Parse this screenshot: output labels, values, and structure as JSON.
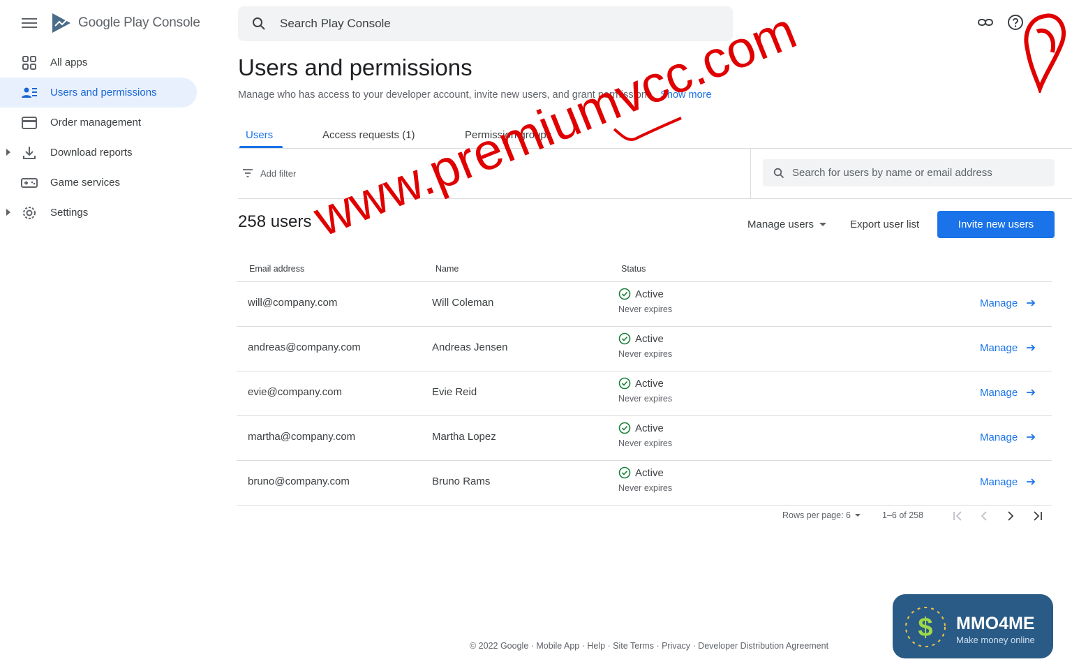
{
  "app": {
    "brand": "Google Play Console"
  },
  "sidebar": {
    "items": [
      {
        "label": "All apps",
        "icon": "grid-icon",
        "active": false,
        "expandable": false
      },
      {
        "label": "Users and permissions",
        "icon": "people-icon",
        "active": true,
        "expandable": false
      },
      {
        "label": "Order management",
        "icon": "credit-card-icon",
        "active": false,
        "expandable": false
      },
      {
        "label": "Download reports",
        "icon": "download-icon",
        "active": false,
        "expandable": true
      },
      {
        "label": "Game services",
        "icon": "gamepad-icon",
        "active": false,
        "expandable": false
      },
      {
        "label": "Settings",
        "icon": "gear-icon",
        "active": false,
        "expandable": true
      }
    ]
  },
  "search": {
    "placeholder": "Search Play Console"
  },
  "page": {
    "title": "Users and permissions",
    "subtitle": "Manage who has access to your developer account, invite new users, and grant permissions.",
    "show_more": "Show more"
  },
  "tabs": [
    {
      "label": "Users",
      "active": true
    },
    {
      "label": "Access requests (1)",
      "active": false
    },
    {
      "label": "Permission groups",
      "active": false
    }
  ],
  "filter": {
    "add_filter": "Add filter",
    "search_placeholder": "Search for users by name or email address"
  },
  "summary": {
    "count_label": "258 users",
    "manage_users": "Manage users",
    "export": "Export user list",
    "invite": "Invite new users"
  },
  "table": {
    "headers": {
      "email": "Email address",
      "name": "Name",
      "status": "Status"
    },
    "rows": [
      {
        "email": "will@company.com",
        "name": "Will Coleman",
        "status": "Active",
        "expires": "Never expires",
        "action": "Manage"
      },
      {
        "email": "andreas@company.com",
        "name": "Andreas Jensen",
        "status": "Active",
        "expires": "Never expires",
        "action": "Manage"
      },
      {
        "email": "evie@company.com",
        "name": "Evie Reid",
        "status": "Active",
        "expires": "Never expires",
        "action": "Manage"
      },
      {
        "email": "martha@company.com",
        "name": "Martha Lopez",
        "status": "Active",
        "expires": "Never expires",
        "action": "Manage"
      },
      {
        "email": "bruno@company.com",
        "name": "Bruno Rams",
        "status": "Active",
        "expires": "Never expires",
        "action": "Manage"
      }
    ]
  },
  "pagination": {
    "rows_per_page": "Rows per page: 6",
    "range": "1–6 of 258"
  },
  "footer": {
    "text": "© 2022 Google · Mobile App · Help · Site Terms · Privacy · Developer Distribution Agreement"
  },
  "overlay": {
    "watermark": "www.premiumvcc.com",
    "badge_title": "MMO4ME",
    "badge_sub": "Make money online"
  },
  "colors": {
    "accent": "#1a73e8",
    "active_bg": "#e8f0fe",
    "success": "#188038",
    "watermark": "#e00000"
  }
}
